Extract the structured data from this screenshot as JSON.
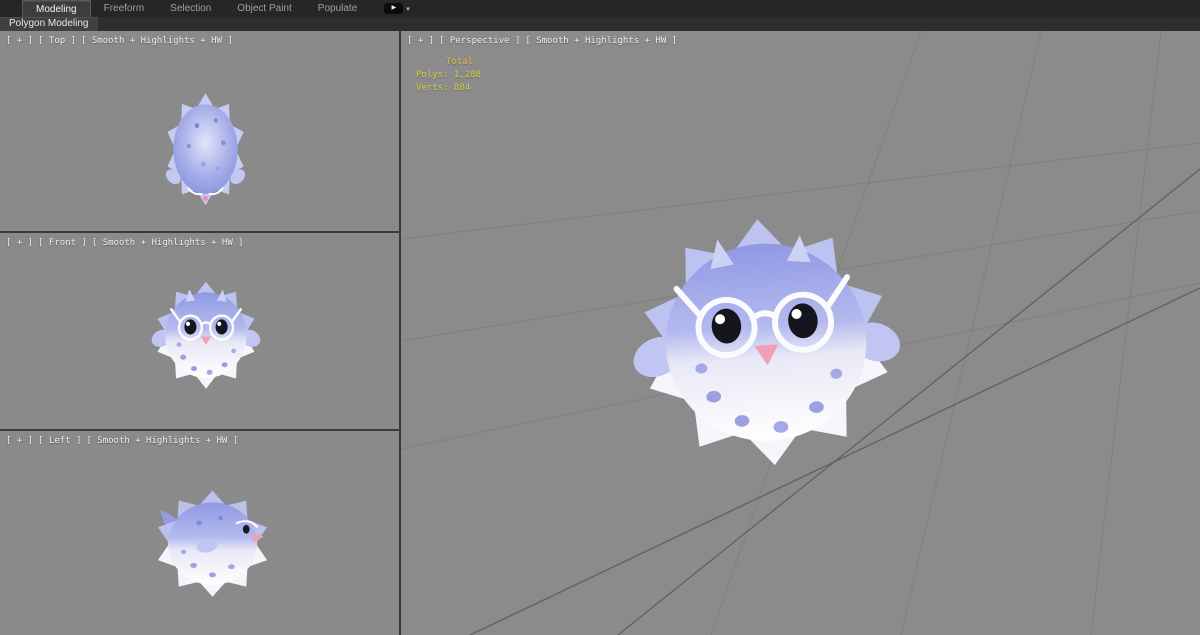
{
  "ribbon": {
    "tabs": [
      {
        "label": "Modeling",
        "active": true
      },
      {
        "label": "Freeform",
        "active": false
      },
      {
        "label": "Selection",
        "active": false
      },
      {
        "label": "Object Paint",
        "active": false
      },
      {
        "label": "Populate",
        "active": false
      }
    ],
    "media_play_glyph": "▶",
    "media_caret_glyph": "▾",
    "subtab": "Polygon Modeling"
  },
  "viewports": {
    "top": {
      "menu_general": "[ + ]",
      "menu_pov": "[ Top ]",
      "menu_shading": "[ Smooth + Highlights + HW ]"
    },
    "front": {
      "menu_general": "[ + ]",
      "menu_pov": "[ Front ]",
      "menu_shading": "[ Smooth + Highlights + HW ]"
    },
    "left": {
      "menu_general": "[ + ]",
      "menu_pov": "[ Left ]",
      "menu_shading": "[ Smooth + Highlights + HW ]"
    },
    "perspective": {
      "menu_general": "[ + ]",
      "menu_pov": "[ Perspective ]",
      "menu_shading": "[ Smooth + Highlights + HW ]"
    }
  },
  "statistics": {
    "total": "Total",
    "polys": "Polys: 1,288",
    "verts": "Verts: 884"
  },
  "colors": {
    "ribbon_bg": "#262626",
    "viewport_bg": "#8a8a8a",
    "stats_text": "#d9cd45",
    "fish_blue": "#99a2e6",
    "fish_belly": "#fbfaff",
    "fish_nose": "#f0a0b2",
    "glasses_white": "#fbfbfe"
  }
}
